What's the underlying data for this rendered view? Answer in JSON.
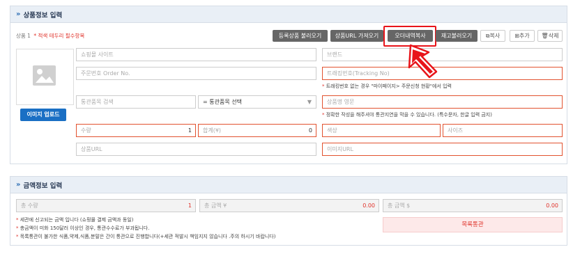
{
  "product_section": {
    "title": "상품정보 입력",
    "product_label": "상품 1",
    "required_note": "* 적색 테두리 필수항목",
    "buttons": {
      "load_registered": "등록상품 불러오기",
      "get_url": "상품URL 가져오기",
      "copy_order": "오더내역복사",
      "load_stock": "재고불러오기",
      "copy": "복사",
      "add": "추가",
      "delete": "삭제"
    },
    "upload_label": "이미지 업로드",
    "fields": {
      "mall_site": "쇼핑몰 사이트",
      "brand": "브랜드",
      "order_no": "주문번호 Order No.",
      "tracking_no": "트래킹번호(Tracking No)",
      "tracking_note": "트래킹번호 없는 경우 \"마이페이지> 주문신청 현황\"에서 입력",
      "customs_search": "통관품목 검색",
      "customs_select": "= 통관품목 선택",
      "product_name_en": "상품명 영문",
      "product_name_note": "정확한 작성을 해주셔야 통관지연을 막을 수 있습니다. (특수문자, 한글 입력 금지)",
      "quantity_label": "수량",
      "quantity_value": "1",
      "sum_label": "합계(¥)",
      "sum_value": "0",
      "color": "색상",
      "size": "사이즈",
      "product_url": "상품URL",
      "image_url": "이미지URL"
    }
  },
  "amount_section": {
    "title": "금액정보 입력",
    "total_qty_label": "총 수량",
    "total_qty_value": "1",
    "total_yen_label": "총 금액 ¥",
    "total_yen_value": "0.00",
    "total_usd_label": "총 금액 $",
    "total_usd_value": "0.00",
    "notes": [
      "세관에 신고되는 금액 입니다 (쇼핑몰 결제 금액과 동일)",
      "총금액이 미화 150달러 이상인 경우, 통관수수료가 부과됩니다.",
      "목록통관이 불가한 식품,약제,식품,분말은 간이 통관으로 진행합니다(+세관 적발시 책임지지 않습니다 .주의 하시기 바랍니다)"
    ],
    "list_clearance": "목록통관"
  },
  "colors": {
    "highlight": "#e8141a",
    "required_border": "#e2522f",
    "button_dark": "#666666",
    "upload_blue": "#1a6fc4"
  }
}
